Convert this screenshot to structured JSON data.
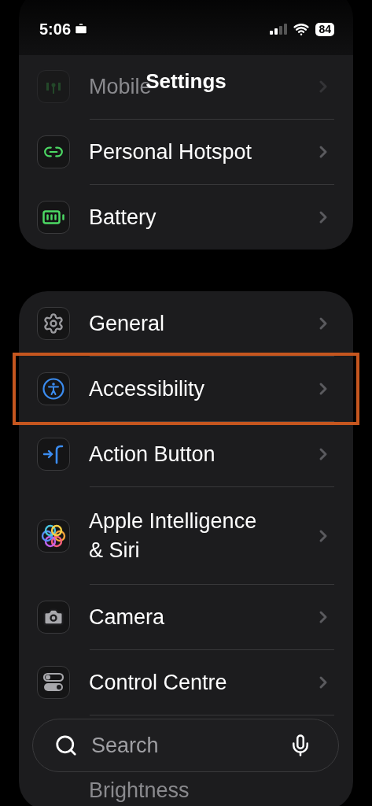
{
  "status_bar": {
    "time": "5:06",
    "battery": "84"
  },
  "title": "Settings",
  "groups": [
    {
      "items": [
        {
          "label": "Mobile",
          "dimmed": true,
          "highlighted": false
        },
        {
          "label": "Personal Hotspot",
          "dimmed": false,
          "highlighted": false
        },
        {
          "label": "Battery",
          "dimmed": false,
          "highlighted": false
        }
      ]
    },
    {
      "items": [
        {
          "label": "General",
          "dimmed": false,
          "highlighted": false
        },
        {
          "label": "Accessibility",
          "dimmed": false,
          "highlighted": true
        },
        {
          "label": "Action Button",
          "dimmed": false,
          "highlighted": false
        },
        {
          "label": "Apple Intelligence & Siri",
          "dimmed": false,
          "highlighted": false
        },
        {
          "label": "Camera",
          "dimmed": false,
          "highlighted": false
        },
        {
          "label": "Control Centre",
          "dimmed": false,
          "highlighted": false
        },
        {
          "label": "Brightness",
          "dimmed": true,
          "highlighted": false
        }
      ]
    }
  ],
  "search": {
    "placeholder": "Search"
  }
}
